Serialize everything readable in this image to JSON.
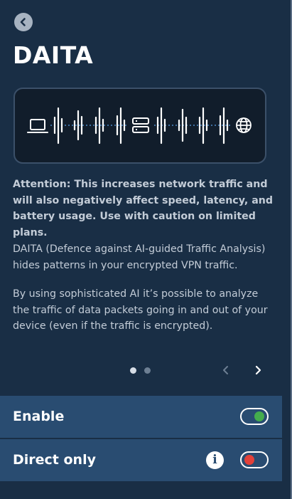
{
  "header": {
    "title": "DAITA",
    "back_icon": "chevron-left-icon"
  },
  "illustration": {
    "left_icon": "laptop-icon",
    "middle_icon": "server-icon",
    "right_icon": "globe-icon"
  },
  "content": {
    "warning": "Attention: This increases network traffic and will also negatively affect speed, latency, and battery usage. Use with caution on limited plans.",
    "paragraph1": "DAITA (Defence against AI-guided Traffic Analysis) hides patterns in your encrypted VPN traffic.",
    "paragraph2": "By using sophisticated AI it’s possible to analyze the traffic of data packets going in and out of your device (even if the traffic is encrypted)."
  },
  "pagination": {
    "current_page": 1,
    "total_pages": 2
  },
  "settings": {
    "enable": {
      "label": "Enable",
      "on": true
    },
    "direct_only": {
      "label": "Direct only",
      "on": false,
      "info_icon": "info-icon"
    }
  },
  "colors": {
    "background": "#192e45",
    "row_background": "#294c71",
    "toggle_on": "#44ad4d",
    "toggle_off": "#e34039",
    "text_muted": "#c3ccd7"
  }
}
